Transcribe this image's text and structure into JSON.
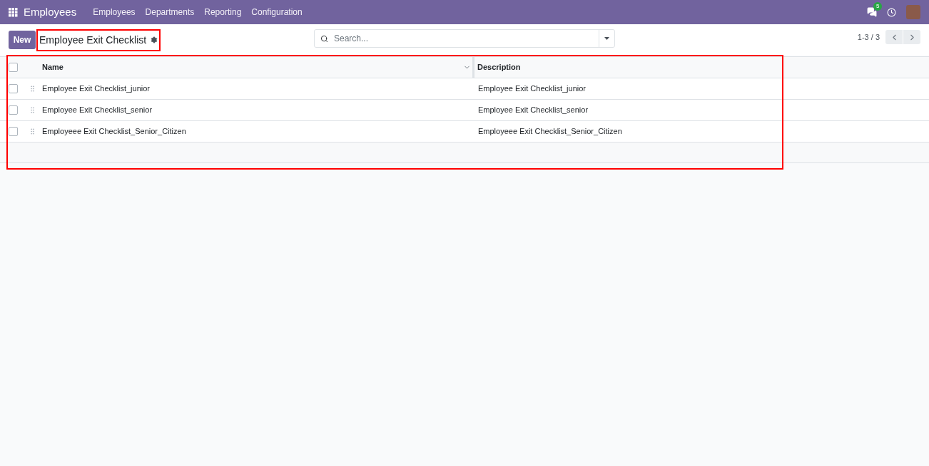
{
  "navbar": {
    "app_name": "Employees",
    "menu": [
      {
        "label": "Employees"
      },
      {
        "label": "Departments"
      },
      {
        "label": "Reporting"
      },
      {
        "label": "Configuration"
      }
    ],
    "message_count": "5"
  },
  "control_panel": {
    "new_button": "New",
    "title": "Employee Exit Checklist",
    "title_highlighted": true,
    "search": {
      "placeholder": "Search..."
    },
    "pager": "1-3 / 3"
  },
  "table": {
    "highlighted": true,
    "select_all_checked": false,
    "columns": [
      {
        "label": "Name"
      },
      {
        "label": "Description"
      }
    ],
    "rows": [
      {
        "checked": false,
        "name": "Employee Exit Checklist_junior",
        "description": "Employee Exit Checklist_junior"
      },
      {
        "checked": false,
        "name": "Employee Exit Checklist_senior",
        "description": "Employee Exit Checklist_senior"
      },
      {
        "checked": false,
        "name": "Employeee Exit Checklist_Senior_Citizen",
        "description": "Employeee Exit Checklist_Senior_Citizen"
      }
    ]
  }
}
